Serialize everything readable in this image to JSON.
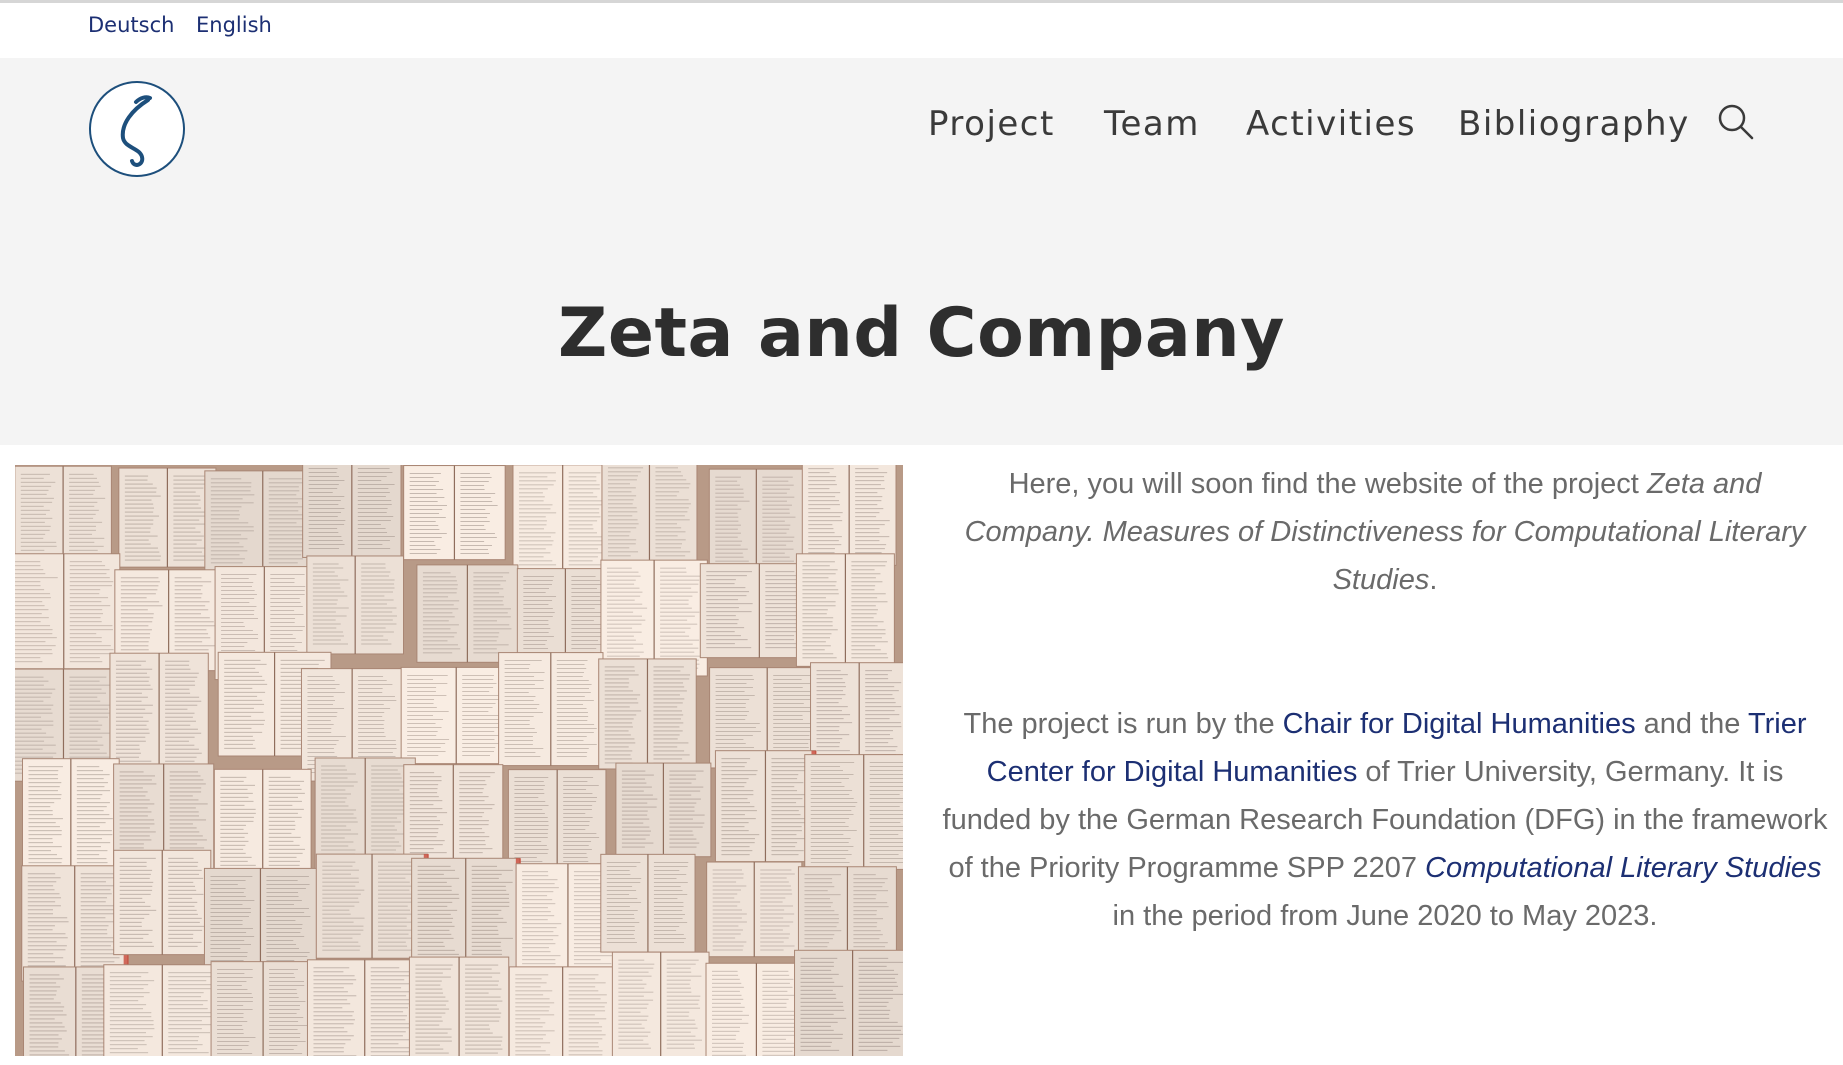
{
  "lang": {
    "de": "Deutsch",
    "en": "English"
  },
  "nav": {
    "project": "Project",
    "team": "Team",
    "activities": "Activities",
    "bibliography": "Bibliography",
    "search_icon": "search-icon"
  },
  "logo": {
    "glyph": "ζ",
    "icon": "zeta-logo"
  },
  "page": {
    "title": "Zeta and Company"
  },
  "hero_image": {
    "icon": "open-books-photo"
  },
  "content": {
    "p1_a": "Here, you will soon find the website of the project ",
    "p1_em": "Zeta and Company. Measures of Distinctiveness for Computational Literary Studies",
    "p1_b": ".",
    "p2_a": "The project is run by the ",
    "p2_link1": "Chair for Digital Humanities",
    "p2_b": " and the ",
    "p2_link2": "Trier Center for Digital Humanities",
    "p2_c": " of Trier University, Germany. It is funded by the German Research Foundation (DFG) in the framework of the Priority Programme SPP 2207 ",
    "p2_link3": "Computational Literary Studies",
    "p2_d": " in the period from June 2020 to May 2023."
  },
  "colors": {
    "link": "#1c2f73",
    "header_bg": "#f4f4f4",
    "logo": "#1d4f7c"
  }
}
